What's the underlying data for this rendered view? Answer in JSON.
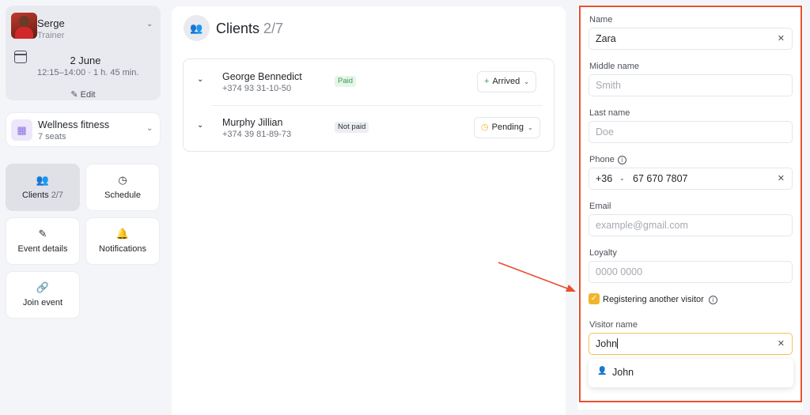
{
  "trainer": {
    "name": "Serge",
    "role": "Trainer",
    "date": "2 June",
    "time": "12:15–14:00 · 1 h. 45 min.",
    "edit_label": "Edit"
  },
  "venue": {
    "name": "Wellness fitness",
    "seats": "7 seats"
  },
  "nav": {
    "clients_label": "Clients",
    "clients_count": "2/7",
    "schedule_label": "Schedule",
    "event_details_label": "Event details",
    "notifications_label": "Notifications",
    "join_event_label": "Join event"
  },
  "clients": {
    "title": "Clients",
    "count": "2/7",
    "rows": [
      {
        "name": "George Bennedict",
        "phone": "+374 93 31-10-50",
        "payment": "Paid",
        "status": "Arrived"
      },
      {
        "name": "Murphy Jillian",
        "phone": "+374 39 81-89-73",
        "payment": "Not paid",
        "status": "Pending"
      }
    ]
  },
  "form": {
    "name_label": "Name",
    "name_value": "Zara",
    "middle_name_label": "Middle name",
    "middle_name_placeholder": "Smith",
    "last_name_label": "Last name",
    "last_name_placeholder": "Doe",
    "phone_label": "Phone",
    "phone_code": "+36",
    "phone_value": "67 670 7807",
    "email_label": "Email",
    "email_placeholder": "example@gmail.com",
    "loyalty_label": "Loyalty",
    "loyalty_placeholder": "0000 0000",
    "register_another_label": "Registering another visitor",
    "register_another_checked": true,
    "visitor_name_label": "Visitor name",
    "visitor_name_value": "John",
    "suggestion": "John"
  },
  "colors": {
    "accent_yellow": "#f1b52b",
    "highlight_red": "#e8502f",
    "paid_green": "#3c9a4e"
  }
}
